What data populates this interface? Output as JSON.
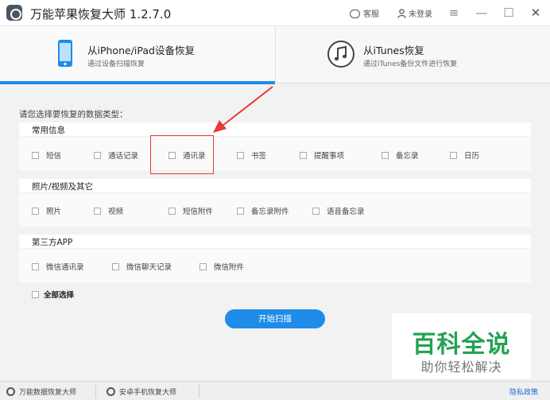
{
  "titlebar": {
    "app_title": "万能苹果恢复大师  1.2.7.0",
    "service_label": "客服",
    "login_label": "未登录",
    "menu_icon": "≡",
    "minimize_icon": "—",
    "maximize_icon": "☐",
    "close_icon": "✕"
  },
  "modes": {
    "device": {
      "title": "从iPhone/iPad设备恢复",
      "subtitle": "通过设备扫描恢复"
    },
    "itunes": {
      "title": "从iTunes恢复",
      "subtitle": "通过iTunes备份文件进行恢复"
    }
  },
  "main": {
    "prompt": "请您选择要恢复的数据类型：",
    "groups": {
      "common": {
        "title": "常用信息",
        "options": [
          "短信",
          "通话记录",
          "通讯录",
          "书签",
          "提醒事项",
          "备忘录",
          "日历"
        ]
      },
      "media": {
        "title": "照片/视频及其它",
        "options": [
          "照片",
          "视频",
          "短信附件",
          "备忘录附件",
          "语音备忘录"
        ]
      },
      "thirdparty": {
        "title": "第三方APP",
        "options": [
          "微信通讯录",
          "微信聊天记录",
          "微信附件"
        ]
      }
    },
    "select_all": "全部选择",
    "scan_button": "开始扫描"
  },
  "watermark": {
    "title": "百科全说",
    "subtitle": "助你轻松解决"
  },
  "statusbar": {
    "item1": "万能数据恢复大师",
    "item2": "安卓手机恢复大师",
    "privacy": "隐私政策"
  },
  "colors": {
    "accent": "#1e8ce8",
    "annotation": "#e53935",
    "watermark_green": "#22a352"
  }
}
